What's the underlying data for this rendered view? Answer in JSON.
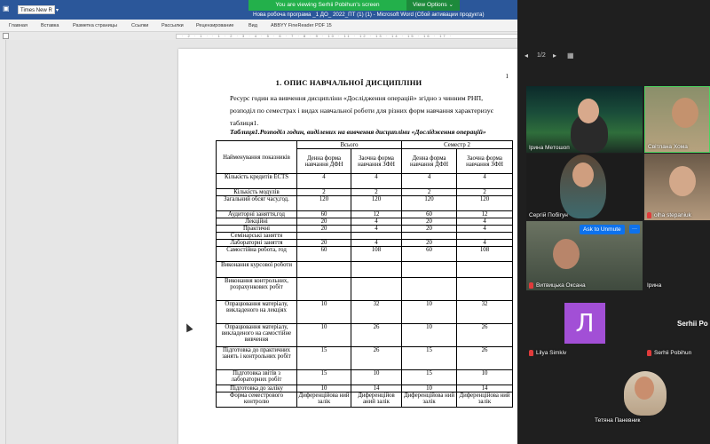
{
  "word": {
    "font_name": "Times New R",
    "doc_title": "Нова робоча програма _1  ДО_ 2022_ПТ (1) (1)  -  Microsoft Word (Сбой активации продукта)",
    "ribbon_tabs": [
      "Главная",
      "Вставка",
      "Разметка страницы",
      "Ссылки",
      "Рассылки",
      "Рецензирование",
      "Вид",
      "ABBYY FineReader PDF 15"
    ],
    "ruler_marks": "· 2 · 1 · · 1 · 2 · 3 · 4 · 5 · 6 · 7 · 8 · 9 · 10 · 11 · 12 · 13 · 14 · 15 · 16 · 17 ·",
    "page_number": "1",
    "heading": "1.   ОПИС НАВЧАЛЬНОЇ ДИСЦИПЛІНИ",
    "paragraph": "Ресурс годин на вивчення дисципліни «Дослідження операцій» згідно з чинним РНП, розподіл по семестрах і видах навчальної роботи для різних форм навчання характеризує таблиця1.",
    "caption": "Таблиця1.Розподіл годин, виділених на вивчення дисципліни «Дослідження операцій»",
    "table": {
      "h_name": "Найменування показників",
      "h_total": "Всього",
      "h_sem": "Семестр 2",
      "h_sub": [
        "Денна форма навчання ДФН",
        "Заочна форма навчання ЗФН",
        "Денна форма навчання ДФН",
        "Заочна форма навчання ЗФН"
      ],
      "rows": [
        {
          "label": "Кількість кредитів ECTS",
          "v": [
            "4",
            "4",
            "4",
            "4"
          ]
        },
        {
          "label": "Кількість модулів",
          "v": [
            "2",
            "2",
            "2",
            "2"
          ]
        },
        {
          "label": "Загальний обсяг часу,год.",
          "v": [
            "120",
            "120",
            "120",
            "120"
          ]
        },
        {
          "label": "Аудиторні заняття,год",
          "v": [
            "60",
            "12",
            "60",
            "12"
          ]
        },
        {
          "label": "Лекційні",
          "v": [
            "20",
            "4",
            "20",
            "4"
          ]
        },
        {
          "label": "Практичні",
          "v": [
            "20",
            "4",
            "20",
            "4"
          ]
        },
        {
          "label": "Семінарські заняття",
          "v": [
            "",
            "",
            "",
            ""
          ]
        },
        {
          "label": "Лабораторні заняття",
          "v": [
            "20",
            "4",
            "20",
            "4"
          ]
        },
        {
          "label": "Самостійна робота, год",
          "v": [
            "60",
            "108",
            "60",
            "108"
          ]
        },
        {
          "label": "Виконання курсової роботи",
          "v": [
            "",
            "",
            "",
            ""
          ]
        },
        {
          "label": "Виконання контрольних, розрахункових робіт",
          "v": [
            "",
            "",
            "",
            ""
          ]
        },
        {
          "label": "Опрацювання матеріалу, викладеного на лекціях",
          "v": [
            "10",
            "32",
            "10",
            "32"
          ]
        },
        {
          "label": "Опрацювання матеріалу, викладеного на самостійне вивчення",
          "v": [
            "10",
            "26",
            "10",
            "26"
          ]
        },
        {
          "label": "Підготовка до практичних занять і контрольних робіт",
          "v": [
            "15",
            "26",
            "15",
            "26"
          ]
        },
        {
          "label": "Підготовка звітів з лабораторних робіт",
          "v": [
            "15",
            "10",
            "15",
            "10"
          ]
        },
        {
          "label": "Підготовка до заліку",
          "v": [
            "10",
            "14",
            "10",
            "14"
          ]
        },
        {
          "label": "Форма семестрового контролю",
          "v": [
            "Диференційова ний залік",
            "Диференційов аний залік",
            "Диференційова ний залік",
            "Диференційова ний залік"
          ]
        }
      ]
    }
  },
  "share_banner": {
    "message": "You are viewing Serhii Pobihun's screen",
    "options": "View Options ⌄"
  },
  "zoom": {
    "page_indicator": "1/2",
    "participants": [
      {
        "name": "Ірина Метошоп",
        "muted": false
      },
      {
        "name": "Світлана Хома",
        "muted": false
      },
      {
        "name": "Сергій Побігун",
        "muted": false
      },
      {
        "name": "olha stepaniuk",
        "muted": true
      },
      {
        "name": "Витвицька Оксана",
        "muted": true
      },
      {
        "name": "Ірина",
        "muted": false
      },
      {
        "name": "Lilya Simkiv",
        "muted": true
      },
      {
        "name": "Serhii Pobihun",
        "muted": true
      },
      {
        "name": "Тетяна Паневник",
        "muted": false
      }
    ],
    "ask_to_unmute": "Ask to Unmute",
    "more": "···",
    "avatar_letter": "Л",
    "serhii_short": "Serhii Po"
  },
  "colors": {
    "word_blue": "#2b579a",
    "zoom_green": "#23b04b",
    "zoom_blue": "#0e72ed",
    "avatar_purple": "#a24fd6"
  }
}
